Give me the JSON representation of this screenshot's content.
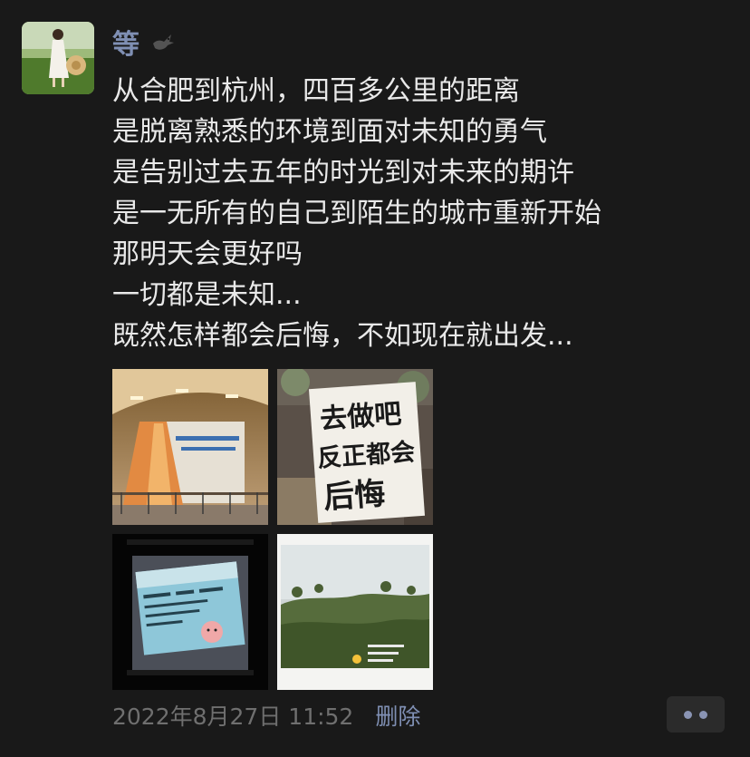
{
  "post": {
    "author_name": "等",
    "content_lines": [
      "从合肥到杭州，四百多公里的距离",
      "是脱离熟悉的环境到面对未知的勇气",
      "是告别过去五年的时光到对未来的期许",
      "是一无所有的自己到陌生的城市重新开始",
      "那明天会更好吗",
      "一切都是未知...",
      "既然怎样都会后悔，不如现在就出发..."
    ],
    "photos": {
      "photo2_sign_text": [
        "去做吧",
        "反正都会",
        "后悔"
      ]
    },
    "timestamp": "2022年8月27日 11:52",
    "delete_label": "删除"
  },
  "colors": {
    "background": "#191919",
    "name_link": "#7f8fb3",
    "text": "#e9e9e9",
    "meta_text": "#6f6f6f",
    "more_button_bg": "#2b2b2b"
  },
  "icons": [
    "dove-icon",
    "more-icon"
  ]
}
